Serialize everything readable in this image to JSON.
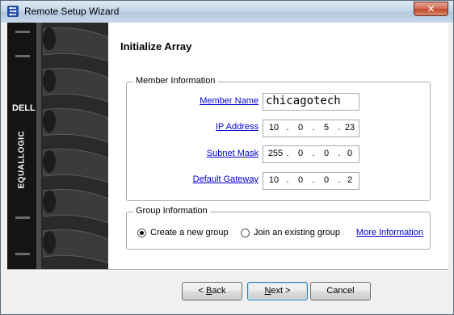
{
  "window": {
    "title": "Remote Setup Wizard",
    "close_label": "✕"
  },
  "banner": {
    "brand_top": "DELL",
    "brand_side": "EQUALLOGIC"
  },
  "page": {
    "title": "Initialize Array"
  },
  "member_info": {
    "legend": "Member Information",
    "member_name_label": "Member Name",
    "member_name_value": "chicagotech",
    "ip_label": "IP Address",
    "ip": [
      "10",
      "0",
      "5",
      "23"
    ],
    "subnet_label": "Subnet Mask",
    "subnet": [
      "255",
      "0",
      "0",
      "0"
    ],
    "gateway_label": "Default Gateway",
    "gateway": [
      "10",
      "0",
      "0",
      "2"
    ]
  },
  "group_info": {
    "legend": "Group Information",
    "create_label": "Create a new group",
    "join_label": "Join an existing group",
    "selected": "create",
    "more_info_label": "More Information"
  },
  "buttons": {
    "back": "< Back",
    "next": "Next >",
    "cancel": "Cancel"
  }
}
